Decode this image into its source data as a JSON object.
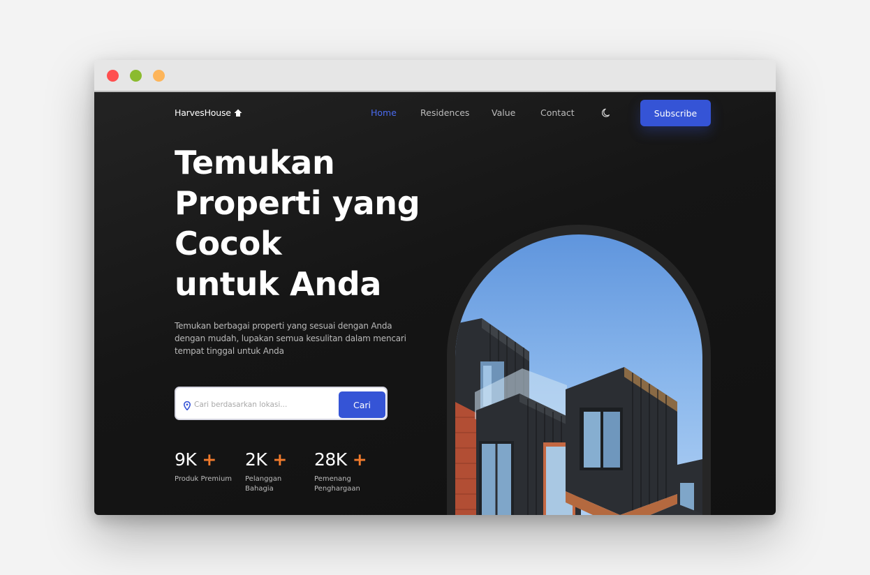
{
  "window": {
    "controls": [
      "close",
      "minimize",
      "maximize"
    ]
  },
  "brand": {
    "name": "HarvesHouse",
    "icon": "house-icon"
  },
  "nav": {
    "items": [
      {
        "label": "Home",
        "active": true
      },
      {
        "label": "Residences",
        "active": false
      },
      {
        "label": "Value",
        "active": false
      },
      {
        "label": "Contact",
        "active": false
      }
    ],
    "theme_toggle_icon": "moon-icon",
    "subscribe_label": "Subscribe"
  },
  "hero": {
    "title_lines": [
      "Temukan",
      "Properti yang",
      "Cocok",
      "untuk Anda"
    ],
    "description": "Temukan berbagai properti yang sesuai dengan Anda dengan mudah, lupakan semua kesulitan dalam mencari tempat tinggal untuk Anda",
    "search": {
      "placeholder": "Cari berdasarkan lokasi...",
      "button_label": "Cari",
      "icon": "location-pin-icon"
    },
    "stats": [
      {
        "value": "9K",
        "suffix": "+",
        "label": "Produk Premium"
      },
      {
        "value": "2K",
        "suffix": "+",
        "label": "Pelanggan Bahagia"
      },
      {
        "value": "28K",
        "suffix": "+",
        "label": "Pemenang Penghargaan"
      }
    ]
  },
  "colors": {
    "accent": "#3554d6",
    "nav_active": "#4a6bf0",
    "plus": "#f07a2c",
    "background": "#151515",
    "sky": "#8ab7ec",
    "building_dark": "#2b2e33",
    "brick": "#b24e34"
  },
  "image": {
    "subject": "modern building facade against blue sky",
    "shape": "arch"
  }
}
